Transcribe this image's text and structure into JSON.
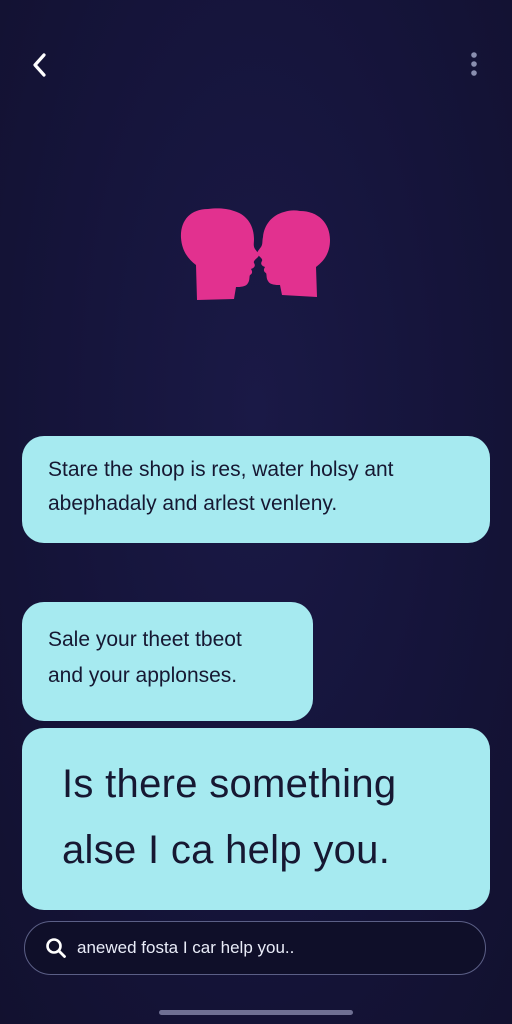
{
  "colors": {
    "background": "#15143a",
    "bubble": "#a6eaf0",
    "accent": "#e2318f",
    "text_dark": "#161832",
    "search_border": "#5b5f86"
  },
  "header": {
    "back_icon": "chevron-left-icon",
    "menu_icon": "more-vertical-icon"
  },
  "logo": {
    "icon": "two-faces-logo-icon"
  },
  "messages": [
    {
      "text": "Stare the shop is res, water holsy ant\nabephadaly and arlest venleny."
    },
    {
      "text": "Sale your theet tbeot\nand your applonses."
    },
    {
      "text": "Is there something\nalse I ca help you."
    }
  ],
  "search": {
    "icon": "search-icon",
    "placeholder": "anewed fosta I car help you.."
  }
}
